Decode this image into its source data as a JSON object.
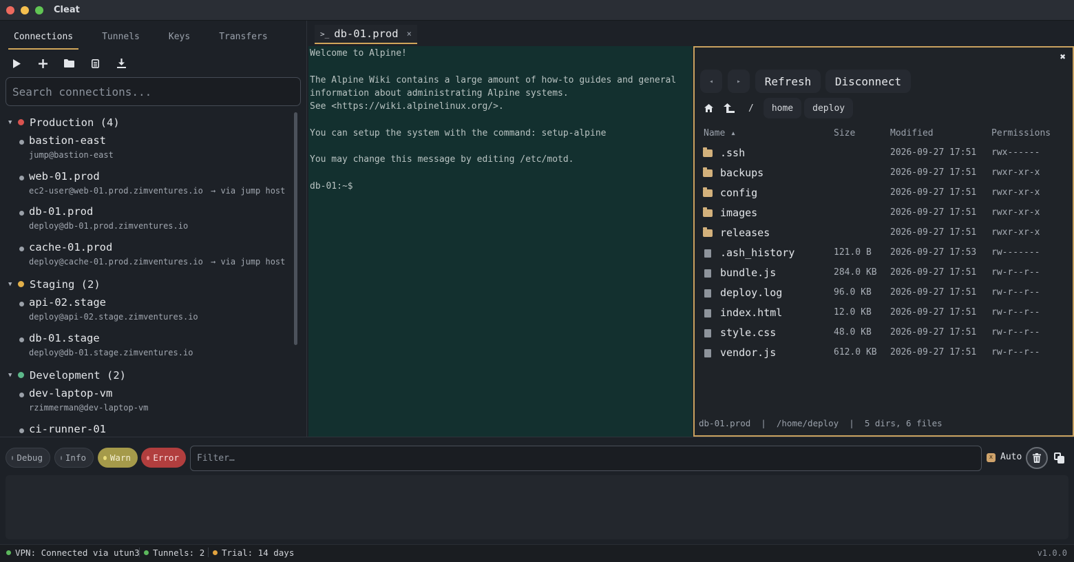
{
  "window": {
    "title": "Cleat",
    "traffic_colors": [
      "#ed6a5e",
      "#f5bf4f",
      "#61c554"
    ]
  },
  "sidebar": {
    "tabs": [
      {
        "label": "Connections",
        "active": true
      },
      {
        "label": "Tunnels",
        "active": false
      },
      {
        "label": "Keys",
        "active": false
      },
      {
        "label": "Transfers",
        "active": false
      }
    ],
    "toolbar_icons": [
      "play-icon",
      "plus-icon",
      "folder-icon",
      "document-icon",
      "download-icon"
    ],
    "search": {
      "placeholder": "Search connections...",
      "value": ""
    },
    "groups": [
      {
        "label": "Production (4)",
        "color": "#d9534f",
        "connections": [
          {
            "name": "bastion-east",
            "host": "jump@bastion-east",
            "via": ""
          },
          {
            "name": "web-01.prod",
            "host": "ec2-user@web-01.prod.zimventures.io",
            "via": "→ via jump host"
          },
          {
            "name": "db-01.prod",
            "host": "deploy@db-01.prod.zimventures.io",
            "via": ""
          },
          {
            "name": "cache-01.prod",
            "host": "deploy@cache-01.prod.zimventures.io",
            "via": "→ via jump host"
          }
        ]
      },
      {
        "label": "Staging (2)",
        "color": "#e2b04a",
        "connections": [
          {
            "name": "api-02.stage",
            "host": "deploy@api-02.stage.zimventures.io",
            "via": ""
          },
          {
            "name": "db-01.stage",
            "host": "deploy@db-01.stage.zimventures.io",
            "via": ""
          }
        ]
      },
      {
        "label": "Development (2)",
        "color": "#5cb88a",
        "connections": [
          {
            "name": "dev-laptop-vm",
            "host": "rzimmerman@dev-laptop-vm",
            "via": ""
          },
          {
            "name": "ci-runner-01",
            "host": "",
            "via": ""
          }
        ]
      }
    ]
  },
  "terminal": {
    "tab": {
      "label": "db-01.prod",
      "close": "×"
    },
    "lines": [
      "Welcome to Alpine!",
      "",
      "The Alpine Wiki contains a large amount of how-to guides and general",
      "information about administrating Alpine systems.",
      "See <https://wiki.alpinelinux.org/>.",
      "",
      "You can setup the system with the command: setup-alpine",
      "",
      "You may change this message by editing /etc/motd.",
      "",
      "db-01:~$"
    ]
  },
  "files": {
    "close": "✖",
    "nav": {
      "back": "◂",
      "forward": "▸",
      "refresh": "Refresh",
      "disconnect": "Disconnect"
    },
    "breadcrumb": [
      "/",
      "home",
      "deploy"
    ],
    "columns": {
      "name": "Name ▴",
      "size": "Size",
      "modified": "Modified",
      "permissions": "Permissions"
    },
    "rows": [
      {
        "name": ".ssh",
        "type": "dir",
        "size": "",
        "modified": "2026-09-27 17:51",
        "perm": "rwx------"
      },
      {
        "name": "backups",
        "type": "dir",
        "size": "",
        "modified": "2026-09-27 17:51",
        "perm": "rwxr-xr-x"
      },
      {
        "name": "config",
        "type": "dir",
        "size": "",
        "modified": "2026-09-27 17:51",
        "perm": "rwxr-xr-x"
      },
      {
        "name": "images",
        "type": "dir",
        "size": "",
        "modified": "2026-09-27 17:51",
        "perm": "rwxr-xr-x"
      },
      {
        "name": "releases",
        "type": "dir",
        "size": "",
        "modified": "2026-09-27 17:51",
        "perm": "rwxr-xr-x"
      },
      {
        "name": ".ash_history",
        "type": "file",
        "size": "121.0 B",
        "modified": "2026-09-27 17:53",
        "perm": "rw-------"
      },
      {
        "name": "bundle.js",
        "type": "file",
        "size": "284.0 KB",
        "modified": "2026-09-27 17:51",
        "perm": "rw-r--r--"
      },
      {
        "name": "deploy.log",
        "type": "file",
        "size": "96.0 KB",
        "modified": "2026-09-27 17:51",
        "perm": "rw-r--r--"
      },
      {
        "name": "index.html",
        "type": "file",
        "size": "12.0 KB",
        "modified": "2026-09-27 17:51",
        "perm": "rw-r--r--"
      },
      {
        "name": "style.css",
        "type": "file",
        "size": "48.0 KB",
        "modified": "2026-09-27 17:51",
        "perm": "rw-r--r--"
      },
      {
        "name": "vendor.js",
        "type": "file",
        "size": "612.0 KB",
        "modified": "2026-09-27 17:51",
        "perm": "rw-r--r--"
      }
    ],
    "status": "db-01.prod  |  /home/deploy  |  5 dirs, 6 files"
  },
  "log": {
    "levels": [
      {
        "label": "Debug",
        "active": false,
        "bg": "#2a2e35",
        "fg": "#a8aeb6",
        "dot": "#6f757d"
      },
      {
        "label": "Info",
        "active": false,
        "bg": "#2a2e35",
        "fg": "#a8aeb6",
        "dot": "#6f757d"
      },
      {
        "label": "Warn",
        "active": true,
        "bg": "#a59a4a",
        "fg": "#f4efd2",
        "dot": "#e9dc7a"
      },
      {
        "label": "Error",
        "active": true,
        "bg": "#b13e3e",
        "fg": "#f7dede",
        "dot": "#f08a8a"
      }
    ],
    "filter_placeholder": "Filter…",
    "auto_label": "Auto",
    "auto_check": "x"
  },
  "statusbar": {
    "items": [
      {
        "label": "VPN: Connected via utun3",
        "color": "#5cb85c"
      },
      {
        "label": "Tunnels: 2",
        "color": "#5cb85c"
      },
      {
        "label": "Trial: 14 days",
        "color": "#e2a33f"
      }
    ],
    "version": "v1.0.0"
  }
}
